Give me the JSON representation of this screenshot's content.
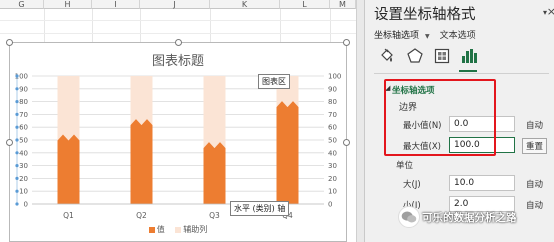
{
  "sheet": {
    "columns": [
      "G",
      "H",
      "I",
      "J",
      "K",
      "L",
      "M"
    ]
  },
  "chart": {
    "title": "图表标题",
    "area_tooltip": "图表区",
    "axis_tooltip": "水平 (类别) 轴",
    "legend": [
      {
        "label": "值",
        "color": "#ed7d31"
      },
      {
        "label": "辅助列",
        "color": "#fbe4d5"
      }
    ]
  },
  "chart_data": {
    "type": "bar",
    "title": "图表标题",
    "categories": [
      "Q1",
      "Q2",
      "Q3",
      "Q4"
    ],
    "series": [
      {
        "name": "值",
        "values": [
          52,
          64,
          46,
          78
        ],
        "color": "#ed7d31"
      },
      {
        "name": "辅助列",
        "values": [
          100,
          100,
          100,
          100
        ],
        "color": "#fbe4d5"
      }
    ],
    "ylim": [
      0,
      100
    ],
    "yticks": [
      0,
      10,
      20,
      30,
      40,
      50,
      60,
      70,
      80,
      90,
      100
    ],
    "secondary_y": true,
    "grid": true,
    "legend_position": "bottom"
  },
  "pane": {
    "title": "设置坐标轴格式",
    "tab_axis_options": "坐标轴选项",
    "tab_text_options": "文本选项",
    "section_heading": "坐标轴选项",
    "bounds_label": "边界",
    "min_label": "最小值(N)",
    "min_value": "0.0",
    "min_button": "自动",
    "max_label": "最大值(X)",
    "max_value": "100.0",
    "max_button": "重置",
    "units_label": "单位",
    "major_label": "大(J)",
    "major_value": "10.0",
    "major_button": "自动",
    "minor_label": "小(I)",
    "minor_value": "2.0",
    "minor_button": "自动",
    "accent": "#217346"
  },
  "watermark": {
    "text": "可乐的数据分析之路"
  }
}
